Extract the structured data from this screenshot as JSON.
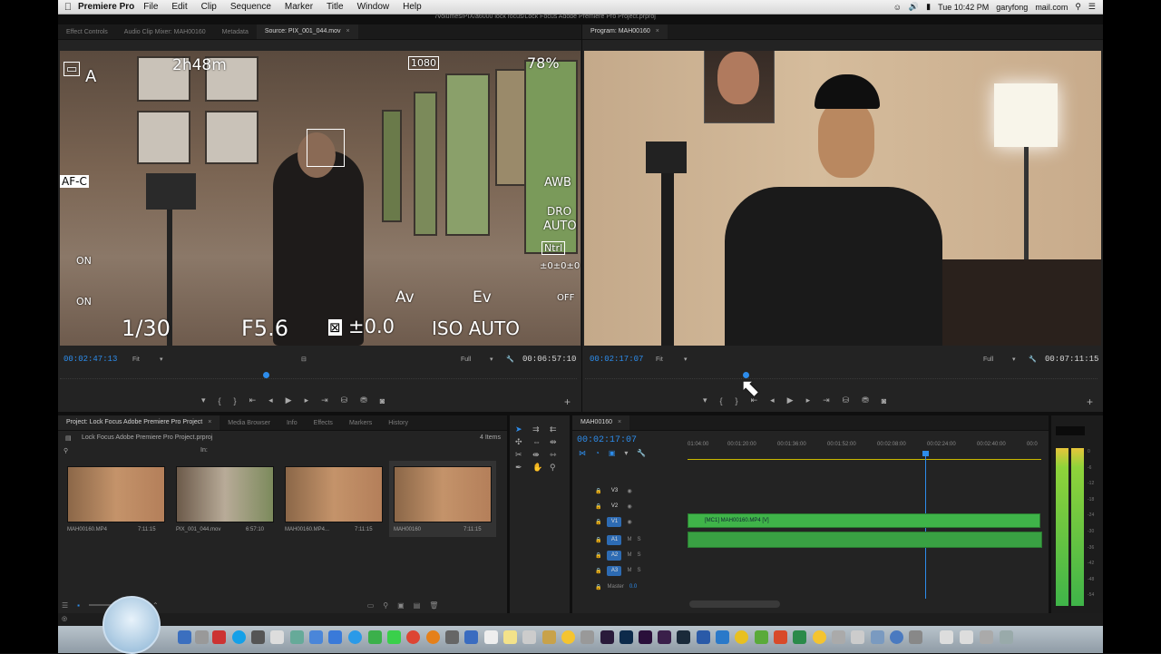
{
  "menubar": {
    "app_name": "Premiere Pro",
    "items": [
      "File",
      "Edit",
      "Clip",
      "Sequence",
      "Marker",
      "Title",
      "Window",
      "Help"
    ],
    "clock": "Tue 10:42 PM",
    "user": "garyfong",
    "mail": "mail.com"
  },
  "path": "/Volumes/PIX/a6000 lock focus/Lock Focus Adobe Premiere Pro Project.prproj",
  "source_panel": {
    "tabs": [
      "Effect Controls",
      "Audio Clip Mixer: MAH00160",
      "Metadata",
      "Source: PIX_001_044.mov"
    ],
    "active_tab": "Source: PIX_001_044.mov",
    "osd": {
      "mode": "A",
      "remaining": "2h48m",
      "quality": "1080",
      "battery": "78%",
      "af": "AF-C",
      "on1": "ON",
      "on2": "ON",
      "wb": "AWB",
      "dro": "DRO",
      "auto": "AUTO",
      "ntrl": "Ntrl",
      "zero": "±0±0±0",
      "av": "Av",
      "ev": "Ev",
      "off": "OFF",
      "shutter": "1/30",
      "aperture": "F5.6",
      "exposure": "±0.0",
      "iso": "ISO AUTO"
    },
    "timecode_in": "00:02:47:13",
    "fit": "Fit",
    "quality": "Full",
    "timecode_out": "00:06:57:10"
  },
  "program_panel": {
    "tab": "Program: MAH00160",
    "timecode_in": "00:02:17:07",
    "fit": "Fit",
    "quality": "Full",
    "timecode_out": "00:07:11:15"
  },
  "project_panel": {
    "tabs": [
      "Project: Lock Focus Adobe Premiere Pro Project",
      "Media Browser",
      "Info",
      "Effects",
      "Markers",
      "History"
    ],
    "active_tab": "Project: Lock Focus Adobe Premiere Pro Project",
    "file": "Lock Focus Adobe Premiere Pro Project.prproj",
    "items_count": "4 Items",
    "search_label": "In:",
    "clips": [
      {
        "name": "MAH00160.MP4",
        "duration": "7:11:15"
      },
      {
        "name": "PIX_001_044.mov",
        "duration": "6:57:10"
      },
      {
        "name": "MAH00160.MP4...",
        "duration": "7:11:15"
      },
      {
        "name": "MAH00160",
        "duration": "7:11:15"
      }
    ]
  },
  "timeline": {
    "tab": "MAH00160",
    "timecode": "00:02:17:07",
    "ruler": [
      "01:04:00",
      "00:01:20:00",
      "00:01:36:00",
      "00:01:52:00",
      "00:02:08:00",
      "00:02:24:00",
      "00:02:40:00",
      "00:0"
    ],
    "tracks": [
      {
        "name": "V3",
        "type": "video"
      },
      {
        "name": "V2",
        "type": "video"
      },
      {
        "name": "V1",
        "type": "video"
      },
      {
        "name": "A1",
        "type": "audio"
      },
      {
        "name": "A2",
        "type": "audio"
      },
      {
        "name": "A3",
        "type": "audio"
      },
      {
        "name": "Master",
        "type": "master",
        "value": "0.0"
      }
    ],
    "clip_label": "[MC1] MAH00160.MP4 [V]"
  },
  "meter_scale": [
    "0",
    "-6",
    "-12",
    "-18",
    "-24",
    "-30",
    "-36",
    "-42",
    "-48",
    "-54"
  ],
  "colors": {
    "accent_blue": "#2d8ceb",
    "clip_green": "#3fb449",
    "panel_bg": "#232323"
  }
}
